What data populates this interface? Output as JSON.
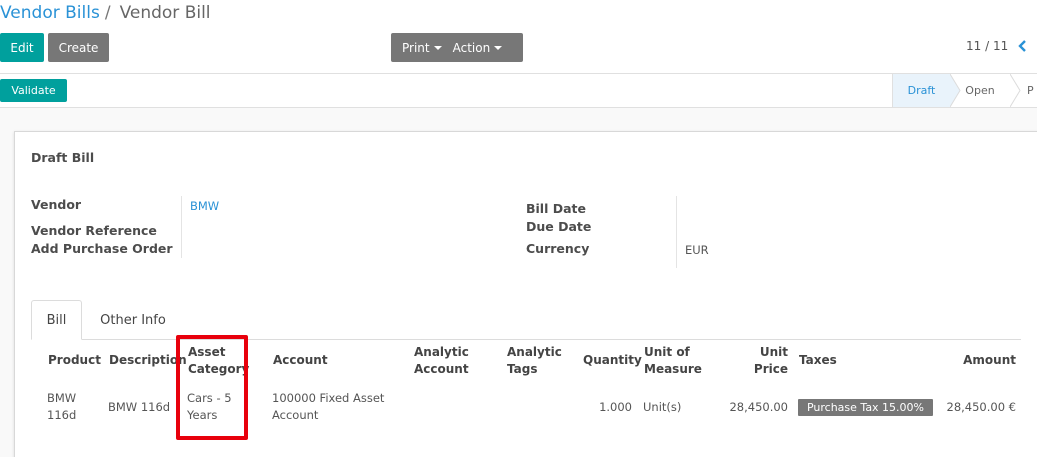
{
  "breadcrumb": {
    "parent": "Vendor Bills",
    "separator": "/",
    "current": "Vendor Bill"
  },
  "toolbar": {
    "edit_label": "Edit",
    "create_label": "Create",
    "print_label": "Print",
    "action_label": "Action"
  },
  "pager": {
    "text": "11 / 11"
  },
  "statusbar": {
    "validate_label": "Validate",
    "stages": [
      "Draft",
      "Open",
      "P"
    ],
    "active_stage": "Draft"
  },
  "form": {
    "title": "Draft Bill",
    "vendor_label": "Vendor",
    "vendor_value": "BMW",
    "vendor_reference_label": "Vendor Reference",
    "add_purchase_order_label": "Add Purchase Order",
    "bill_date_label": "Bill Date",
    "due_date_label": "Due Date",
    "currency_label": "Currency",
    "currency_value": "EUR"
  },
  "tabs": [
    "Bill",
    "Other Info"
  ],
  "table": {
    "headers": {
      "product": "Product",
      "description": "Description",
      "asset_category_1": "Asset",
      "asset_category_2": "Category",
      "account": "Account",
      "analytic_account_1": "Analytic",
      "analytic_account_2": "Account",
      "analytic_tags_1": "Analytic",
      "analytic_tags_2": "Tags",
      "quantity": "Quantity",
      "uom_1": "Unit of",
      "uom_2": "Measure",
      "unit_price_1": "Unit",
      "unit_price_2": "Price",
      "taxes": "Taxes",
      "amount": "Amount"
    },
    "rows": [
      {
        "product_1": "BMW",
        "product_2": "116d",
        "description": "BMW 116d",
        "asset_category_1": "Cars - 5",
        "asset_category_2": "Years",
        "account_1": "100000 Fixed Asset",
        "account_2": "Account",
        "quantity": "1.000",
        "uom": "Unit(s)",
        "unit_price": "28,450.00",
        "tax": "Purchase Tax 15.00%",
        "amount": "28,450.00 €"
      }
    ]
  },
  "colors": {
    "accent": "#00a09d",
    "link": "#2a92d6",
    "highlight": "#e8000c",
    "grey_button": "#777777"
  }
}
